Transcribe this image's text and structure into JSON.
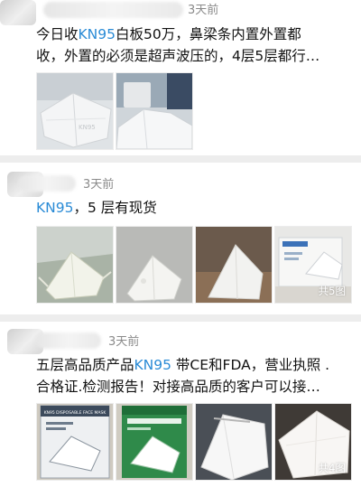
{
  "posts": [
    {
      "time": "3天前",
      "lines": [
        {
          "prefix": "今日收",
          "highlight": "KN95",
          "suffix": "白板50万，鼻梁条内置外置都"
        },
        {
          "prefix": "收，外置的必须是超声波压的，4层5层都行…",
          "highlight": "",
          "suffix": ""
        }
      ]
    },
    {
      "time": "3天前",
      "lines": [
        {
          "prefix": "",
          "highlight": "KN95",
          "suffix": "，5 层有现货"
        }
      ],
      "image_count_label": "共5图"
    },
    {
      "time": "3天前",
      "lines": [
        {
          "prefix": "五层高品质产品",
          "highlight": "KN95",
          "suffix": " 带CE和FDA，营业执照 ."
        },
        {
          "prefix": "合格证.检测报告！对接高品质的客户可以接…",
          "highlight": "",
          "suffix": ""
        }
      ],
      "image_count_label": "共4图",
      "package_label": "KN95 DISPOSABLE FACE MASK"
    }
  ],
  "colors": {
    "link": "#2a8bd6",
    "divider": "#ededed",
    "time": "#8a8a8a"
  }
}
